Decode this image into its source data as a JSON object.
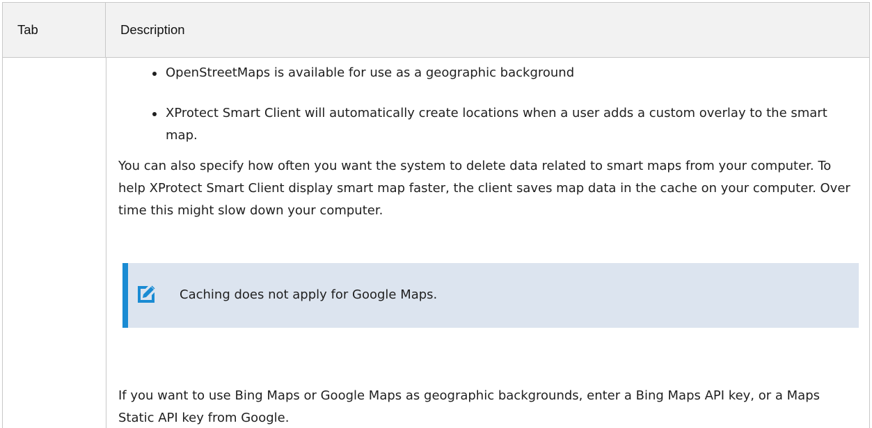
{
  "table": {
    "headers": {
      "tab": "Tab",
      "description": "Description"
    },
    "row": {
      "tab": "",
      "bullets": [
        "OpenStreetMaps is available for use as a geographic background",
        "XProtect Smart Client will automatically create locations when a user adds a custom overlay to the smart map."
      ],
      "paragraph1": "You can also specify how often you want the system to delete data related to smart maps from your computer. To help XProtect Smart Client display smart map faster, the client saves map data in the cache on your computer. Over time this might slow down your computer.",
      "note": {
        "icon": "pencil-edit-icon",
        "text": "Caching does not apply for Google Maps."
      },
      "paragraph2": "If you want to use Bing Maps or Google Maps as geographic backgrounds, enter a Bing Maps API key, or a Maps Static API key from Google."
    }
  },
  "colors": {
    "header_bg": "#f2f2f2",
    "border": "#c8c8c8",
    "note_bg": "#dce4ef",
    "note_accent": "#1a8bd3"
  }
}
